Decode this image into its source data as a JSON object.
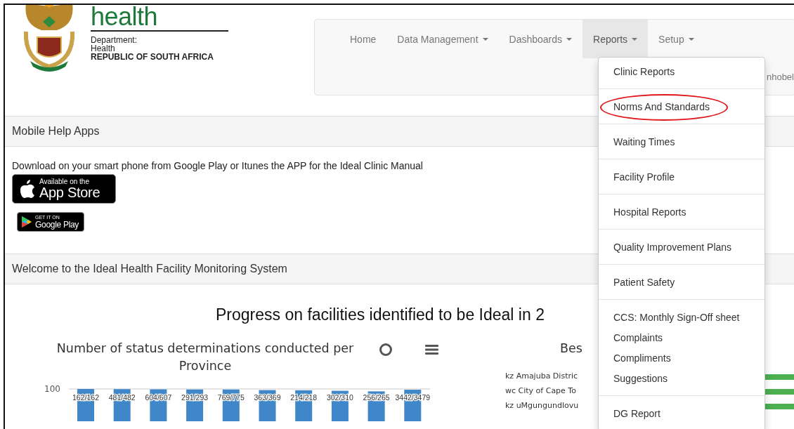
{
  "header": {
    "logo_word": "health",
    "department_label": "Department:",
    "department_name": "Health",
    "country": "REPUBLIC OF SOUTH AFRICA"
  },
  "nav": {
    "items": [
      {
        "label": "Home",
        "dropdown": false,
        "selected": false
      },
      {
        "label": "Data Management",
        "dropdown": true,
        "selected": false
      },
      {
        "label": "Dashboards",
        "dropdown": true,
        "selected": false
      },
      {
        "label": "Reports",
        "dropdown": true,
        "selected": true
      },
      {
        "label": "Setup",
        "dropdown": true,
        "selected": false
      }
    ],
    "user_text": "nhobel"
  },
  "reports_menu": {
    "groups": [
      {
        "items": [
          {
            "label": "Clinic Reports",
            "circled": false
          }
        ]
      },
      {
        "items": [
          {
            "label": "Norms And Standards",
            "circled": true
          }
        ]
      },
      {
        "items": [
          {
            "label": "Waiting Times",
            "circled": false
          }
        ]
      },
      {
        "items": [
          {
            "label": "Facility Profile",
            "circled": false
          }
        ]
      },
      {
        "items": [
          {
            "label": "Hospital Reports",
            "circled": false
          }
        ]
      },
      {
        "items": [
          {
            "label": "Quality Improvement Plans",
            "circled": false
          }
        ]
      },
      {
        "items": [
          {
            "label": "Patient Safety",
            "circled": false
          }
        ]
      },
      {
        "items": [
          {
            "label": "CCS: Monthly Sign-Off sheet",
            "circled": false
          },
          {
            "label": "Complaints",
            "circled": false
          },
          {
            "label": "Compliments",
            "circled": false
          },
          {
            "label": "Suggestions",
            "circled": false
          }
        ]
      },
      {
        "items": [
          {
            "label": "DG Report",
            "circled": false
          }
        ]
      }
    ]
  },
  "mobile_help": {
    "title": "Mobile Help Apps",
    "text": "Download on your smart phone from Google Play or Itunes the APP for the Ideal Clinic Manual",
    "badges": [
      {
        "kind": "app_store",
        "small": "Available on the",
        "big": "App Store"
      },
      {
        "kind": "google_play",
        "small": "GET IT ON",
        "big": "Google Play"
      }
    ]
  },
  "welcome": {
    "title": "Welcome to the Ideal Health Facility Monitoring System",
    "heading": "Progress on facilities identified to be Ideal in 2",
    "status_chart": {
      "title": "Number of status determinations conducted per Province",
      "ytick": "100",
      "bar_labels": [
        "162/162",
        "481/482",
        "604/607",
        "291/293",
        "769/775",
        "363/369",
        "214/218",
        "302/310",
        "256/265",
        "3442/3479"
      ]
    },
    "best_chart": {
      "title": "Bes",
      "rows": [
        "kz Amajuba Distric",
        "wc City of Cape To",
        "kz uMgungundlovu"
      ]
    }
  }
}
